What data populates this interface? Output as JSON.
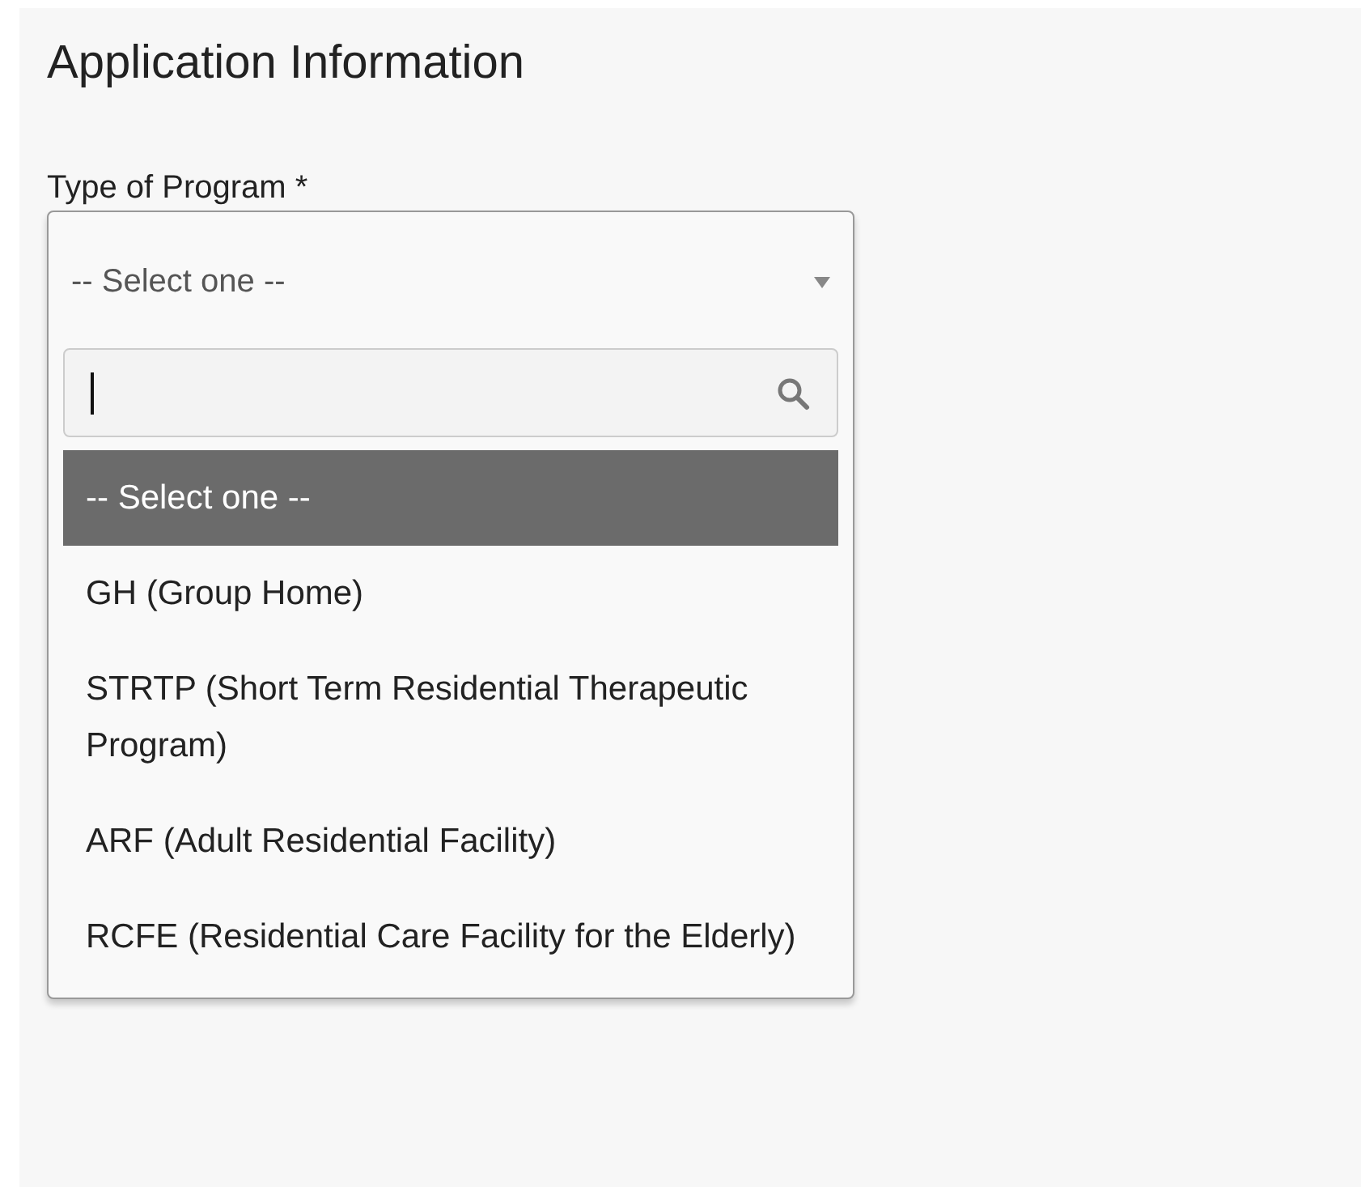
{
  "section": {
    "title": "Application Information"
  },
  "field": {
    "label": "Type of Program *",
    "value": "-- Select one --",
    "expanded": true
  },
  "options": [
    {
      "label": "-- Select one --",
      "selected": true
    },
    {
      "label": "GH (Group Home)",
      "selected": false
    },
    {
      "label": "STRTP (Short Term Residential Therapeutic Program)",
      "selected": false
    },
    {
      "label": "ARF (Adult Residential Facility)",
      "selected": false
    },
    {
      "label": "RCFE (Residential Care Facility for the Elderly)",
      "selected": false
    }
  ]
}
